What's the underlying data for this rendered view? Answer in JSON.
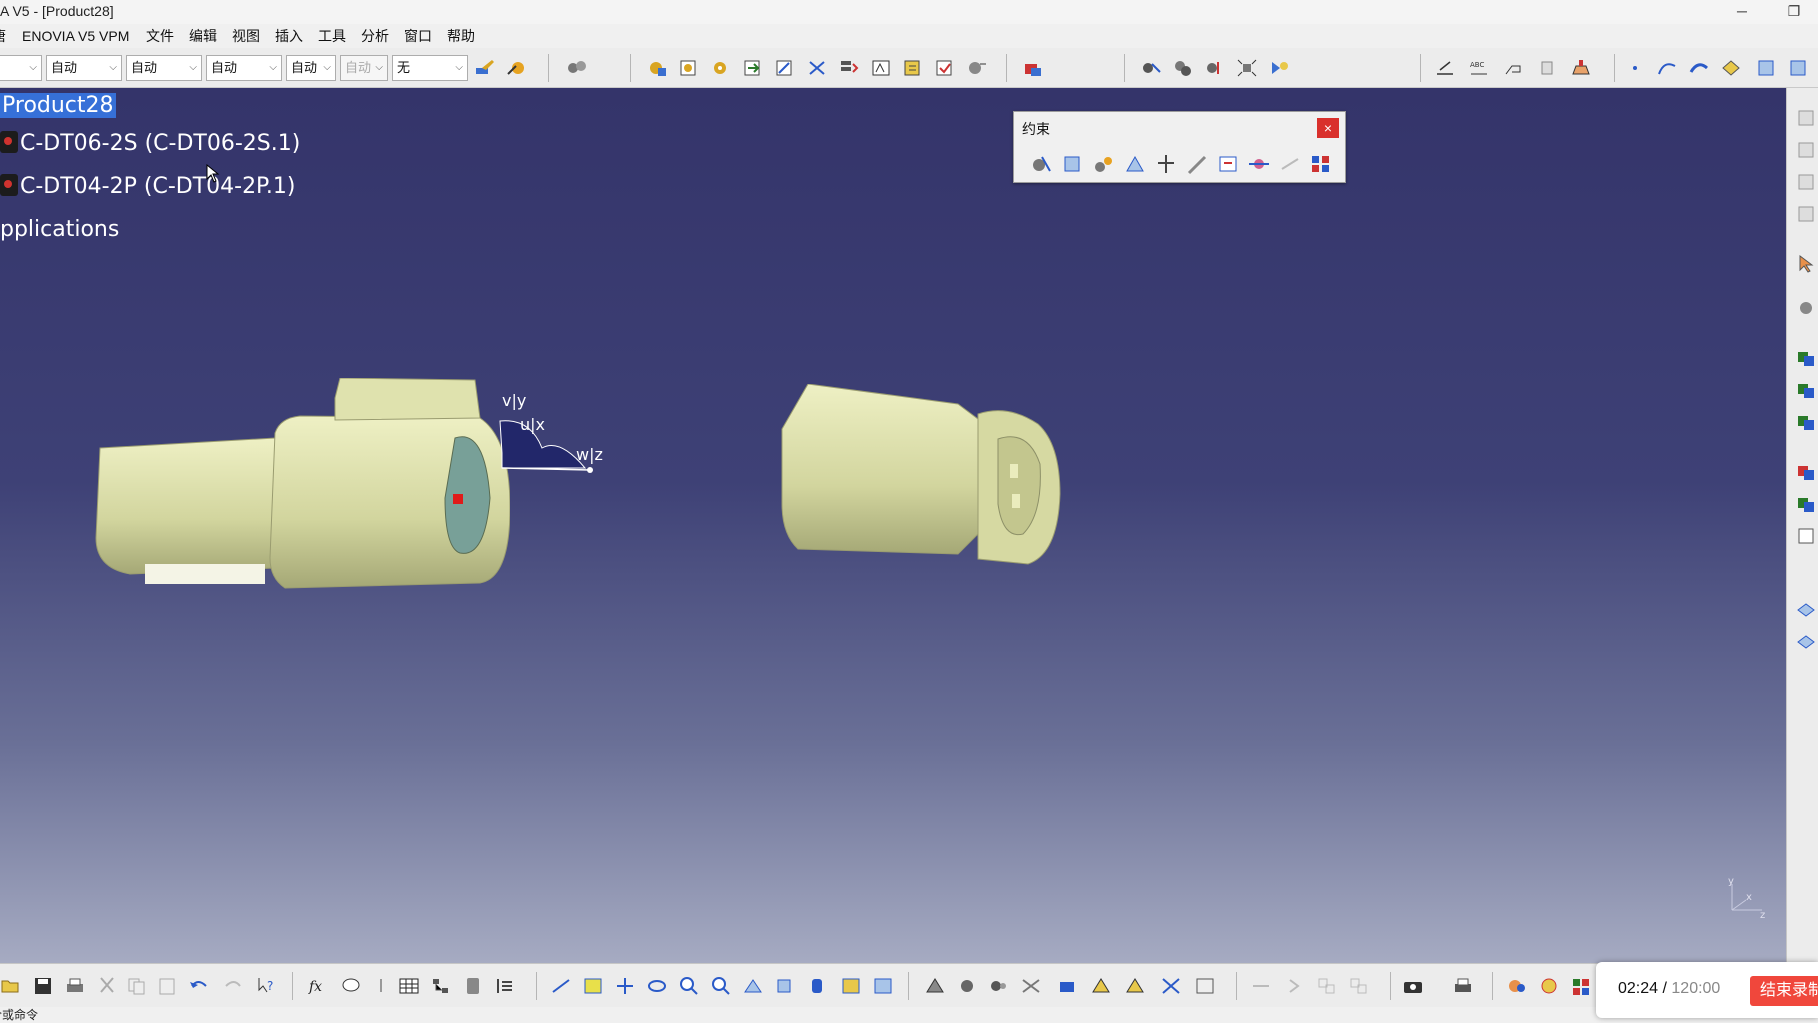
{
  "window": {
    "title": "A V5 - [Product28]",
    "minimize": "─",
    "restore": "❐"
  },
  "menu": {
    "items": [
      "ENOVIA V5 VPM",
      "文件",
      "编辑",
      "视图",
      "插入",
      "工具",
      "分析",
      "窗口",
      "帮助"
    ],
    "leading": "唐"
  },
  "toolbar": {
    "combos": [
      "",
      "自动",
      "自动",
      "自动",
      "自动",
      "自动",
      "无"
    ]
  },
  "tree": {
    "root": "Product28",
    "children": [
      "C-DT06-2S (C-DT06-2S.1)",
      "C-DT04-2P (C-DT04-2P.1)"
    ],
    "applications": "pplications"
  },
  "constraint_toolbar": {
    "title": "约束",
    "close": "×"
  },
  "compass": {
    "v": "v|y",
    "u": "u|x",
    "w": "w|z"
  },
  "axis_triad": {
    "y": "y",
    "x": "x",
    "z": "z"
  },
  "status": {
    "text": "令或命令"
  },
  "recorder": {
    "elapsed": "02:24",
    "separator": " / ",
    "total": "120:00",
    "stop_label": "结束录制"
  },
  "colors": {
    "part": "#d9dca6",
    "part_shade": "#9ea173",
    "selection": "#3670d8",
    "stop": "#f0473c"
  }
}
